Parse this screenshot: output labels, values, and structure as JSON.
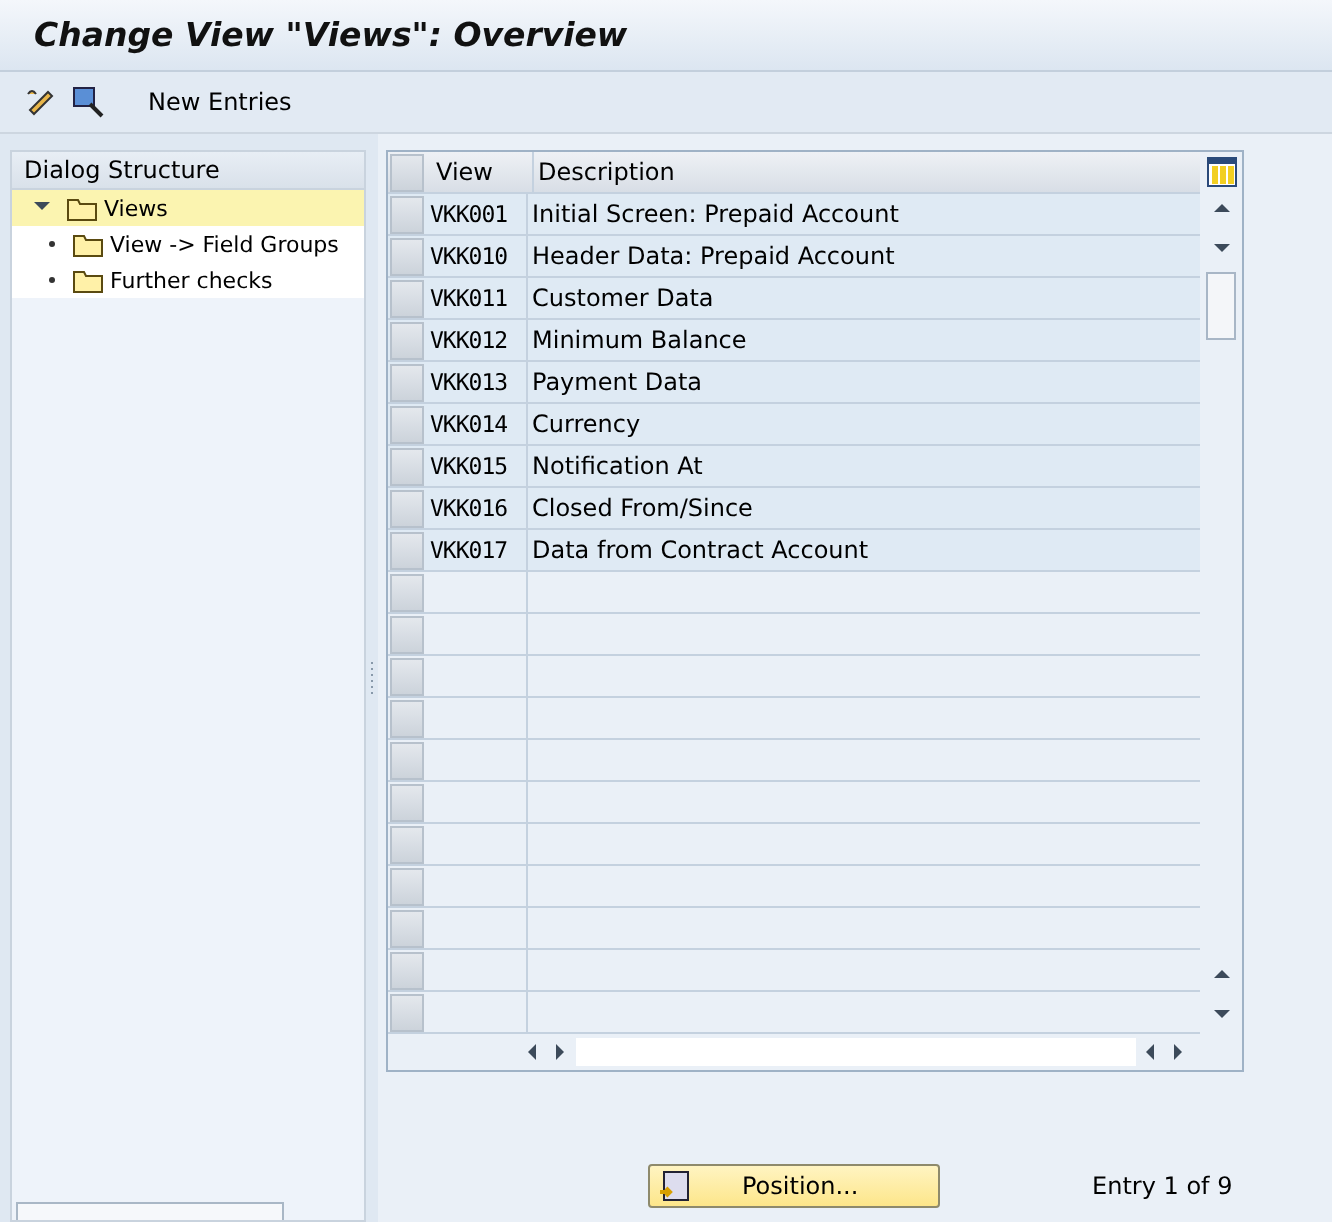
{
  "window": {
    "title": "Change View \"Views\": Overview"
  },
  "toolbar": {
    "buttons": [
      {
        "label": "New Entries"
      }
    ]
  },
  "dialog_structure": {
    "title": "Dialog Structure",
    "items": [
      {
        "label": "Views",
        "selected": true,
        "expanded": true,
        "children": [
          {
            "label": "View -> Field Groups",
            "selected": false
          },
          {
            "label": "Further checks",
            "selected": false
          }
        ]
      }
    ]
  },
  "table": {
    "columns": [
      "View",
      "Description"
    ],
    "rows": [
      [
        "VKK001",
        "Initial Screen: Prepaid Account"
      ],
      [
        "VKK010",
        "Header Data: Prepaid Account"
      ],
      [
        "VKK011",
        "Customer Data"
      ],
      [
        "VKK012",
        "Minimum Balance"
      ],
      [
        "VKK013",
        "Payment Data"
      ],
      [
        "VKK014",
        "Currency"
      ],
      [
        "VKK015",
        "Notification At"
      ],
      [
        "VKK016",
        "Closed From/Since"
      ],
      [
        "VKK017",
        "Data from Contract Account"
      ]
    ]
  },
  "footer": {
    "button": "Position...",
    "entry_info": "Entry 1 of 9"
  }
}
